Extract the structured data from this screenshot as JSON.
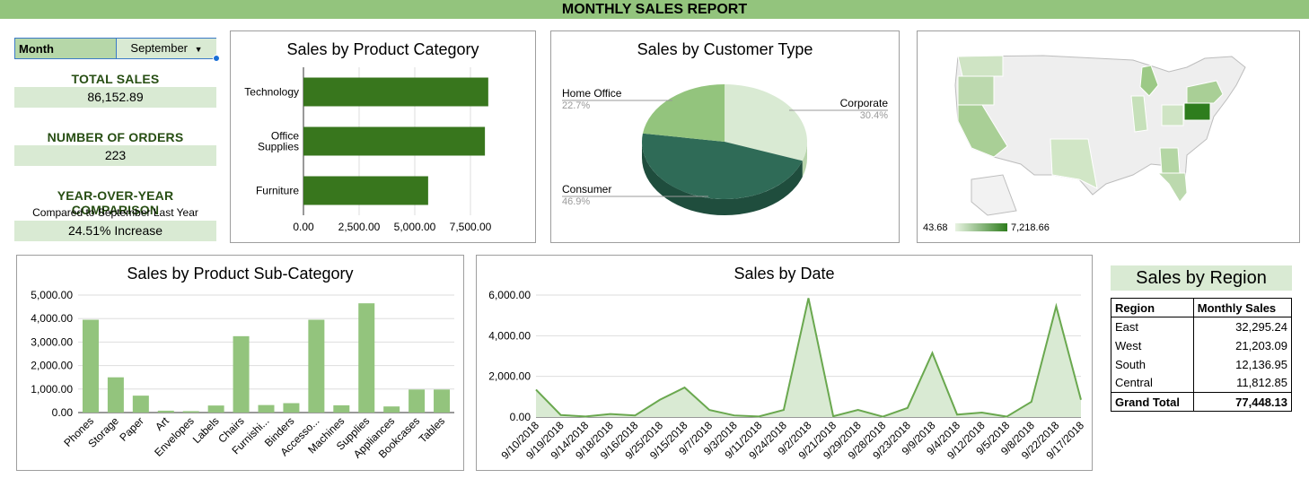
{
  "header": {
    "title": "MONTHLY SALES REPORT"
  },
  "filter": {
    "label": "Month",
    "selected": "September"
  },
  "kpis": {
    "total_sales_label": "TOTAL SALES",
    "total_sales_value": "86,152.89",
    "orders_label": "NUMBER OF ORDERS",
    "orders_value": "223",
    "yoy_label": "YEAR-OVER-YEAR COMPARISON",
    "yoy_sub": "Compared to September Last Year",
    "yoy_value": "24.51%  Increase"
  },
  "colors": {
    "banner": "#93c47d",
    "dark_green": "#38761d",
    "bar_green": "#93c47d",
    "light_panel": "#d9ead3"
  },
  "map": {
    "legend_min": "43.68",
    "legend_max": "7,218.66"
  },
  "region_table": {
    "title": "Sales by Region",
    "col1": "Region",
    "col2": "Monthly Sales",
    "rows": [
      {
        "region": "East",
        "sales": "32,295.24"
      },
      {
        "region": "West",
        "sales": "21,203.09"
      },
      {
        "region": "South",
        "sales": "12,136.95"
      },
      {
        "region": "Central",
        "sales": "11,812.85"
      }
    ],
    "total_label": "Grand Total",
    "total_value": "77,448.13"
  },
  "chart_data": [
    {
      "type": "bar",
      "orientation": "horizontal",
      "title": "Sales by Product Category",
      "categories": [
        "Technology",
        "Office Supplies",
        "Furniture"
      ],
      "category_lines": [
        [
          "Technology"
        ],
        [
          "Office",
          "Supplies"
        ],
        [
          "Furniture"
        ]
      ],
      "values": [
        8300,
        8150,
        5600
      ],
      "xlim": [
        0,
        10000
      ],
      "xticks": [
        "0.00",
        "2,500.00",
        "5,000.00",
        "7,500.00"
      ],
      "grid": true
    },
    {
      "type": "pie",
      "title": "Sales by Customer Type",
      "labels": [
        "Corporate",
        "Consumer",
        "Home Office"
      ],
      "values": [
        30.4,
        46.9,
        22.7
      ],
      "pct_labels": [
        "30.4%",
        "46.9%",
        "22.7%"
      ],
      "colors": [
        "#d9ead3",
        "#2f6b57",
        "#93c47d"
      ]
    },
    {
      "type": "bar",
      "title": "Sales by Product Sub-Category",
      "categories": [
        "Phones",
        "Storage",
        "Paper",
        "Art",
        "Envelopes",
        "Labels",
        "Chairs",
        "Furnishi...",
        "Binders",
        "Accesso...",
        "Machines",
        "Supplies",
        "Appliances",
        "Bookcases",
        "Tables"
      ],
      "values": [
        3950,
        1500,
        720,
        80,
        60,
        300,
        3250,
        320,
        400,
        3950,
        310,
        4650,
        260,
        980,
        980
      ],
      "ylim": [
        0,
        5000
      ],
      "yticks": [
        "0.00",
        "1,000.00",
        "2,000.00",
        "3,000.00",
        "4,000.00",
        "5,000.00"
      ],
      "grid": true
    },
    {
      "type": "area",
      "title": "Sales by Date",
      "x": [
        "9/10/2018",
        "9/19/2018",
        "9/14/2018",
        "9/18/2018",
        "9/16/2018",
        "9/25/2018",
        "9/15/2018",
        "9/7/2018",
        "9/3/2018",
        "9/11/2018",
        "9/24/2018",
        "9/2/2018",
        "9/21/2018",
        "9/29/2018",
        "9/28/2018",
        "9/23/2018",
        "9/9/2018",
        "9/4/2018",
        "9/12/2018",
        "9/5/2018",
        "9/8/2018",
        "9/22/2018",
        "9/17/2018"
      ],
      "values": [
        1350,
        100,
        30,
        150,
        80,
        850,
        1450,
        350,
        80,
        30,
        350,
        5850,
        40,
        350,
        20,
        450,
        3150,
        120,
        220,
        20,
        750,
        5450,
        850
      ],
      "ylim": [
        0,
        6000
      ],
      "yticks": [
        "0.00",
        "2,000.00",
        "4,000.00",
        "6,000.00"
      ],
      "grid": true
    }
  ]
}
